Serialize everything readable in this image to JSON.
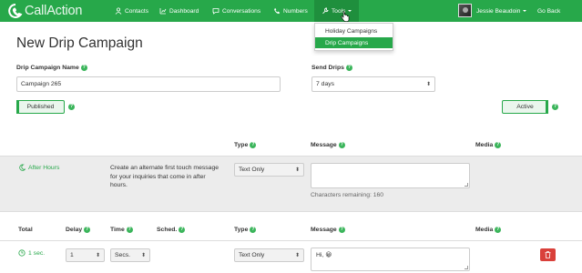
{
  "brand": {
    "name_part1": "Call",
    "name_part2": "Action"
  },
  "nav": {
    "items": [
      {
        "label": "Contacts",
        "icon": "contacts-icon"
      },
      {
        "label": "Dashboard",
        "icon": "dashboard-icon"
      },
      {
        "label": "Conversations",
        "icon": "conversations-icon"
      },
      {
        "label": "Numbers",
        "icon": "phone-icon"
      },
      {
        "label": "Tools",
        "icon": "wrench-icon"
      }
    ],
    "user_name": "Jessie Beaudoin",
    "go_back": "Go Back"
  },
  "tools_menu": {
    "items": [
      {
        "label": "Holiday Campaigns",
        "active": false
      },
      {
        "label": "Drip Campaigns",
        "active": true
      }
    ]
  },
  "page": {
    "title": "New Drip Campaign"
  },
  "form": {
    "name_label": "Drip Campaign Name",
    "name_value": "Campaign 265",
    "send_label": "Send Drips",
    "send_value": "7 days",
    "published_label": "Published",
    "active_label": "Active"
  },
  "after_hours": {
    "headers": {
      "type": "Type",
      "message": "Message",
      "media": "Media"
    },
    "link_label": "After Hours",
    "description": "Create an alternate first touch message for your inquiries that come in after hours.",
    "type_value": "Text Only",
    "message_value": "",
    "chars_remaining": "Characters remaining: 160"
  },
  "drips": {
    "headers": {
      "total": "Total",
      "delay": "Delay",
      "time": "Time",
      "sched": "Sched.",
      "type": "Type",
      "message": "Message",
      "media": "Media"
    },
    "rows": [
      {
        "total": "1 sec.",
        "delay": "1",
        "time": "Secs.",
        "type": "Text Only",
        "message": "Hi, 😀"
      }
    ]
  },
  "colors": {
    "brand_green": "#27a84a",
    "danger_red": "#d9403a",
    "row_gray": "#ececec"
  }
}
